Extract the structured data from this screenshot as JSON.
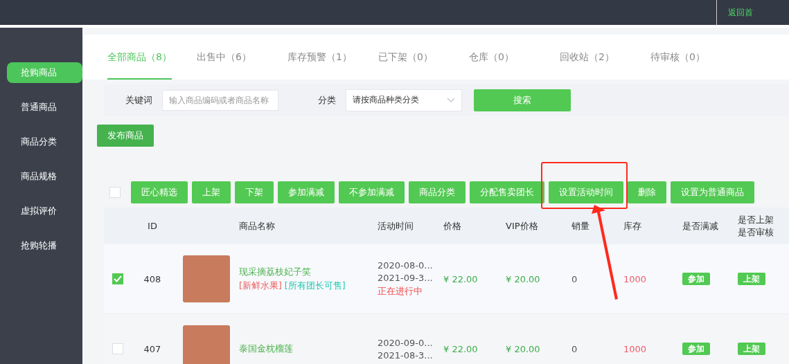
{
  "topbar": {
    "link": "返回首"
  },
  "sidebar": {
    "items": [
      {
        "label": "抢购商品",
        "selected": true
      },
      {
        "label": "普通商品",
        "selected": false
      },
      {
        "label": "商品分类",
        "selected": false
      },
      {
        "label": "商品规格",
        "selected": false
      },
      {
        "label": "虚拟评价",
        "selected": false
      },
      {
        "label": "抢购轮播",
        "selected": false
      }
    ]
  },
  "tabs": [
    {
      "label": "全部商品（8）",
      "selected": true
    },
    {
      "label": "出售中（6）",
      "selected": false
    },
    {
      "label": "库存预警（1）",
      "selected": false
    },
    {
      "label": "已下架（0）",
      "selected": false
    },
    {
      "label": "仓库（0）",
      "selected": false
    },
    {
      "label": "回收站（2）",
      "selected": false
    },
    {
      "label": "待审核（0）",
      "selected": false
    }
  ],
  "filter": {
    "keyword_label": "关键词",
    "keyword_placeholder": "输入商品编码或者商品名称",
    "category_label": "分类",
    "category_value": "请按商品种类分类",
    "search_button": "搜索"
  },
  "publish_button": "发布商品",
  "select_all": {
    "checked": false
  },
  "actions": [
    {
      "label": "匠心精选",
      "highlighted": false
    },
    {
      "label": "上架",
      "highlighted": false
    },
    {
      "label": "下架",
      "highlighted": false
    },
    {
      "label": "参加满减",
      "highlighted": false
    },
    {
      "label": "不参加满减",
      "highlighted": false
    },
    {
      "label": "商品分类",
      "highlighted": false
    },
    {
      "label": "分配售卖团长",
      "highlighted": false
    },
    {
      "label": "设置活动时间",
      "highlighted": true
    },
    {
      "label": "删除",
      "highlighted": false
    },
    {
      "label": "设置为普通商品",
      "highlighted": false
    }
  ],
  "table": {
    "columns": [
      "ID",
      "商品名称",
      "活动时间",
      "价格",
      "VIP价格",
      "销量",
      "库存",
      "是否满减",
      "是否上架是否审核"
    ],
    "rows": [
      {
        "checked": true,
        "id": "408",
        "name": "现采摘荔枝妃子笑",
        "tags": [
          "[新鲜水果]",
          "[所有团长可售]"
        ],
        "start": "2020-08-0...",
        "end": "2021-09-3...",
        "status": "正在进行中",
        "price": "¥ 22.00",
        "vip_price": "¥ 20.00",
        "sales": "0",
        "stock": "1000",
        "discount": "参加",
        "shelf": "上架"
      },
      {
        "checked": false,
        "id": "407",
        "name": "泰国金枕榴莲",
        "start": "2020-09-0...",
        "end": "2021-08-3...",
        "price": "¥ 22.00",
        "vip_price": "¥ 20.00",
        "sales": "0",
        "stock": "1000",
        "discount": "参加",
        "shelf": "上架"
      }
    ]
  }
}
